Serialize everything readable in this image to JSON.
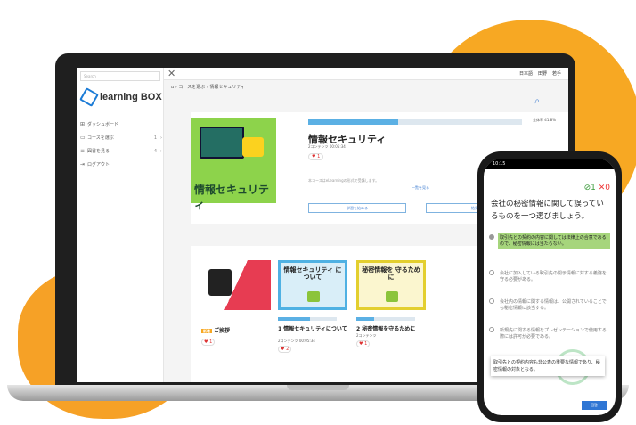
{
  "sidebar": {
    "search_placeholder": "Search",
    "brand": "learning BOX",
    "items": [
      {
        "label": "ダッシュボード",
        "icon": "dashboard-icon",
        "count": ""
      },
      {
        "label": "コースを選ぶ",
        "icon": "course-icon",
        "count": "1"
      },
      {
        "label": "図書を見る",
        "icon": "book-icon",
        "count": "4"
      },
      {
        "label": "ログアウト",
        "icon": "logout-icon",
        "count": ""
      }
    ]
  },
  "topbar": {
    "language": "日本語",
    "user": "田野",
    "role": "若手"
  },
  "breadcrumb": [
    "コースを選ぶ",
    "情報セキュリティ"
  ],
  "course": {
    "thumb_title": "情報セキュリティ",
    "title": "情報セキュリティ",
    "progress_label": "全体率 41.8%",
    "progress": 0.42,
    "meta": "2コンテンツ  00:05:34",
    "likes": "1",
    "note": "本コースはeLearningの形式で受講します。",
    "more": "一覧を見る",
    "btn1": "学習を始める",
    "btn2": "結果"
  },
  "lessons": [
    {
      "card_title": "",
      "title": "ご挨拶",
      "badge": "新着",
      "progress": 0.0,
      "likes": "1",
      "meta": ""
    },
    {
      "card_title": "情報セキュリティ について",
      "title": "1 情報セキュリティについて",
      "progress": 0.55,
      "likes": "2",
      "meta": "2コンテンツ  00:05:34"
    },
    {
      "card_title": "秘密情報を 守るために",
      "title": "2 秘密情報を守るために",
      "progress": 0.3,
      "likes": "1",
      "meta": "2コンテンツ"
    }
  ],
  "phone": {
    "time": "10:15",
    "score_ok": "1",
    "score_ng": "0",
    "question": "会社の秘密情報に関して誤っているものを一つ選びましょう。",
    "options": [
      {
        "text": "取引先との契約の内容に関しては法律上の合意であるので、秘密情報には当たらない。",
        "selected": true
      },
      {
        "text": "会社に加入している取引先の開示情報に対する義務を守る必要がある。",
        "selected": false
      },
      {
        "text": "会社内の情報に関する情報は、公開されていることでも秘密情報に該当する。",
        "selected": false
      },
      {
        "text": "新規先に関する情報をプレゼンテーションで使用する際には許可が必要である。",
        "selected": false
      }
    ],
    "tip": "取引先との契約内容も非公表の重要な情報であり、秘密情報の対象となる。",
    "submit": "回答"
  }
}
